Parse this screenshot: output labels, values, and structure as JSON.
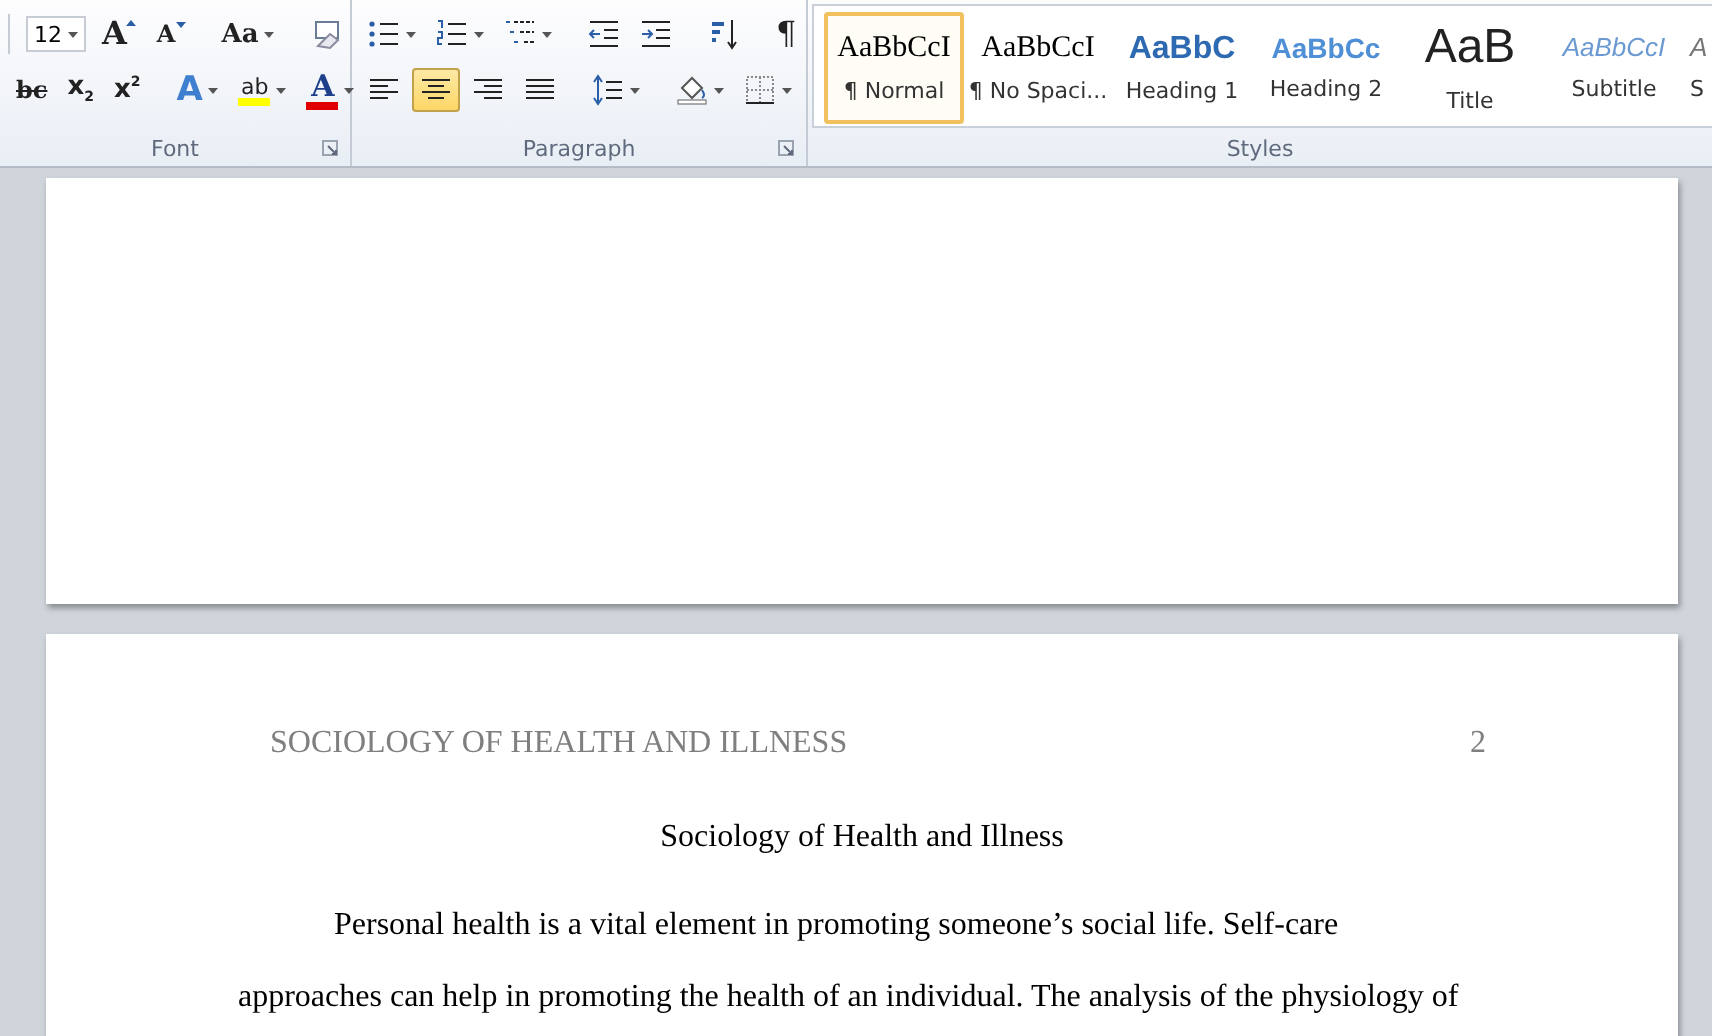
{
  "ribbon": {
    "groups": [
      {
        "kind": "font",
        "label": "Font",
        "font_size": "12",
        "rows": [
          {
            "tools": [
              {
                "kind": "grow",
                "text": "A",
                "dropdown": false,
                "selected": false
              },
              {
                "kind": "shrink",
                "text": "A",
                "dropdown": false,
                "selected": false
              },
              {
                "kind": "case",
                "text": "Aa",
                "dropdown": true,
                "selected": false
              },
              {
                "kind": "clear",
                "dropdown": false,
                "selected": false
              }
            ]
          },
          {
            "tools": [
              {
                "kind": "strike",
                "text": "bc",
                "dropdown": false,
                "selected": false
              },
              {
                "kind": "sub",
                "text": "x",
                "sub": "2",
                "dropdown": false,
                "selected": false
              },
              {
                "kind": "sup",
                "text": "x",
                "sub": "2",
                "dropdown": false,
                "selected": false
              },
              {
                "kind": "effects",
                "text": "A",
                "dropdown": true,
                "selected": false
              },
              {
                "kind": "highlight",
                "text": "ab",
                "dropdown": true,
                "selected": false
              },
              {
                "kind": "fontcolor",
                "text": "A",
                "dropdown": true,
                "selected": false
              }
            ]
          }
        ]
      },
      {
        "kind": "paragraph",
        "label": "Paragraph",
        "rows": [
          {
            "tools": [
              {
                "kind": "bullets",
                "dropdown": true,
                "selected": false
              },
              {
                "kind": "numbering",
                "dropdown": true,
                "selected": false
              },
              {
                "kind": "multilevel",
                "dropdown": true,
                "selected": false
              },
              {
                "kind": "outdent",
                "dropdown": false,
                "selected": false
              },
              {
                "kind": "indent",
                "dropdown": false,
                "selected": false
              },
              {
                "kind": "sort",
                "dropdown": false,
                "selected": false
              },
              {
                "kind": "pilcrow",
                "text": "¶",
                "dropdown": false,
                "selected": false
              }
            ]
          },
          {
            "tools": [
              {
                "kind": "left",
                "dropdown": false,
                "selected": false
              },
              {
                "kind": "center",
                "dropdown": false,
                "selected": true
              },
              {
                "kind": "right",
                "dropdown": false,
                "selected": false
              },
              {
                "kind": "justify",
                "dropdown": false,
                "selected": false
              },
              {
                "kind": "spacing",
                "dropdown": true,
                "selected": false
              },
              {
                "kind": "shading",
                "dropdown": true,
                "selected": false
              },
              {
                "kind": "borders",
                "dropdown": true,
                "selected": false
              }
            ]
          }
        ]
      },
      {
        "kind": "styles",
        "label": "Styles",
        "styles": [
          {
            "kind": "normal",
            "preview": "AaBbCcI",
            "label": "¶ Normal",
            "selected": true
          },
          {
            "kind": "normal",
            "preview": "AaBbCcI",
            "label": "¶ No Spaci...",
            "selected": false
          },
          {
            "kind": "heading1",
            "preview": "AaBbC",
            "label": "Heading 1",
            "selected": false
          },
          {
            "kind": "heading2",
            "preview": "AaBbCc",
            "label": "Heading 2",
            "selected": false
          },
          {
            "kind": "title",
            "preview": "AaB",
            "label": "Title",
            "selected": false
          },
          {
            "kind": "subtitle",
            "preview": "AaBbCcI",
            "label": "Subtitle",
            "selected": false
          },
          {
            "kind": "subtle",
            "preview": "A",
            "label": "S",
            "selected": false
          }
        ]
      }
    ]
  },
  "document": {
    "header": {
      "title": "SOCIOLOGY OF HEALTH AND ILLNESS",
      "page_number": "2"
    },
    "title": "Sociology of Health and Illness",
    "paragraph": "Personal health is a vital element in promoting someone’s social life. Self-care approaches can help in promoting the health of an individual. The analysis of the physiology of"
  }
}
